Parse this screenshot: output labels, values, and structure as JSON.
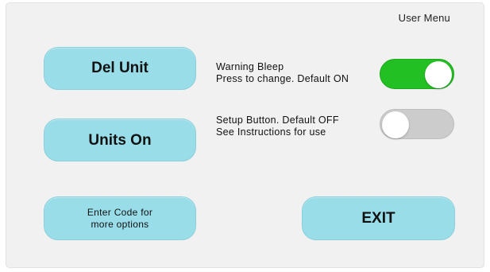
{
  "header": {
    "title": "User Menu"
  },
  "buttons": {
    "del_unit": "Del Unit",
    "units_on": "Units On",
    "enter_code": "Enter Code for\nmore options",
    "exit": "EXIT"
  },
  "settings": {
    "warning_bleep": {
      "line1": "Warning Bleep",
      "line2": "Press to change. Default ON",
      "state": "on"
    },
    "setup_button": {
      "line1": "Setup Button. Default OFF",
      "line2": "See Instructions for use",
      "state": "off"
    }
  },
  "colors": {
    "button_fill": "#99dde9",
    "toggle_on": "#22c022",
    "toggle_off": "#cccccc",
    "panel_bg": "#f1f1f1"
  }
}
